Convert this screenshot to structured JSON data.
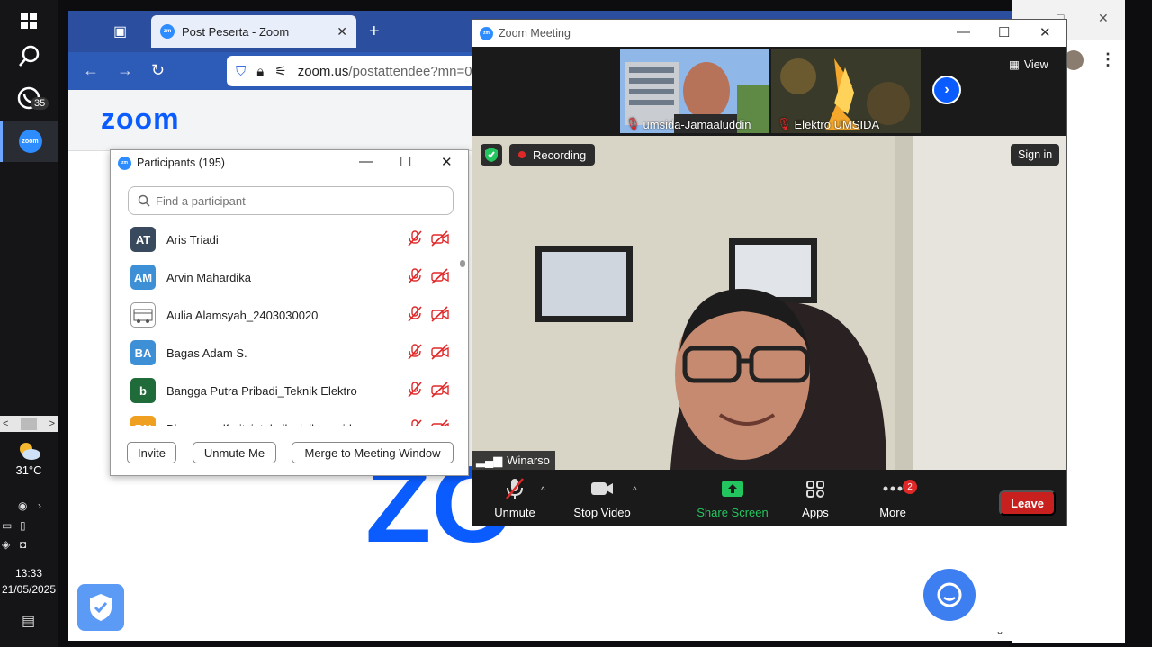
{
  "taskbar": {
    "windows_icon": "windows-logo-icon",
    "search_icon": "search-icon",
    "whatsapp_badge": "35",
    "zoom_app_label": "zoom",
    "weather_temp": "31°C",
    "clock_time": "13:33",
    "clock_date": "21/05/2025"
  },
  "browser": {
    "tab_title": "Post Peserta - Zoom",
    "url_domain": "zoom.us",
    "url_path": "/postattendee?mn=0",
    "logo": "zoom",
    "big_logo_partial": "ZO"
  },
  "participants": {
    "title": "Participants (195)",
    "search_placeholder": "Find a participant",
    "list": [
      {
        "initials": "AT",
        "name": "Aris Triadi",
        "color": "#3a4a5e"
      },
      {
        "initials": "AM",
        "name": "Arvin Mahardika",
        "color": "#3d8fd6"
      },
      {
        "initials": "",
        "name": "Aulia Alamsyah_2403030020",
        "color": "#ffffff"
      },
      {
        "initials": "BA",
        "name": "Bagas Adam S.",
        "color": "#3d8fd6"
      },
      {
        "initials": "b",
        "name": "Bangga Putra Pribadi_Teknik Elektro",
        "color": "#1f6b3a"
      },
      {
        "initials": "BN",
        "name": "Bima nur alfaritsi_teknik sipil_umsida",
        "color": "#f0a020"
      }
    ],
    "invite_label": "Invite",
    "unmute_me_label": "Unmute Me",
    "merge_label": "Merge to Meeting Window"
  },
  "meeting": {
    "title": "Zoom Meeting",
    "view_label": "View",
    "thumb1_name": "umsida-Jamaaluddin",
    "thumb2_name": "Elektro UMSIDA",
    "recording_label": "Recording",
    "signin_label": "Sign in",
    "speaker_name": "Winarso",
    "toolbar": {
      "unmute": "Unmute",
      "stop_video": "Stop Video",
      "share_screen": "Share Screen",
      "apps": "Apps",
      "more": "More",
      "more_badge": "2",
      "leave": "Leave"
    }
  },
  "colors": {
    "zoom_blue": "#0b5cff",
    "share_green": "#23c55e",
    "leave_red": "#c7201f",
    "muted_red": "#e02828"
  }
}
